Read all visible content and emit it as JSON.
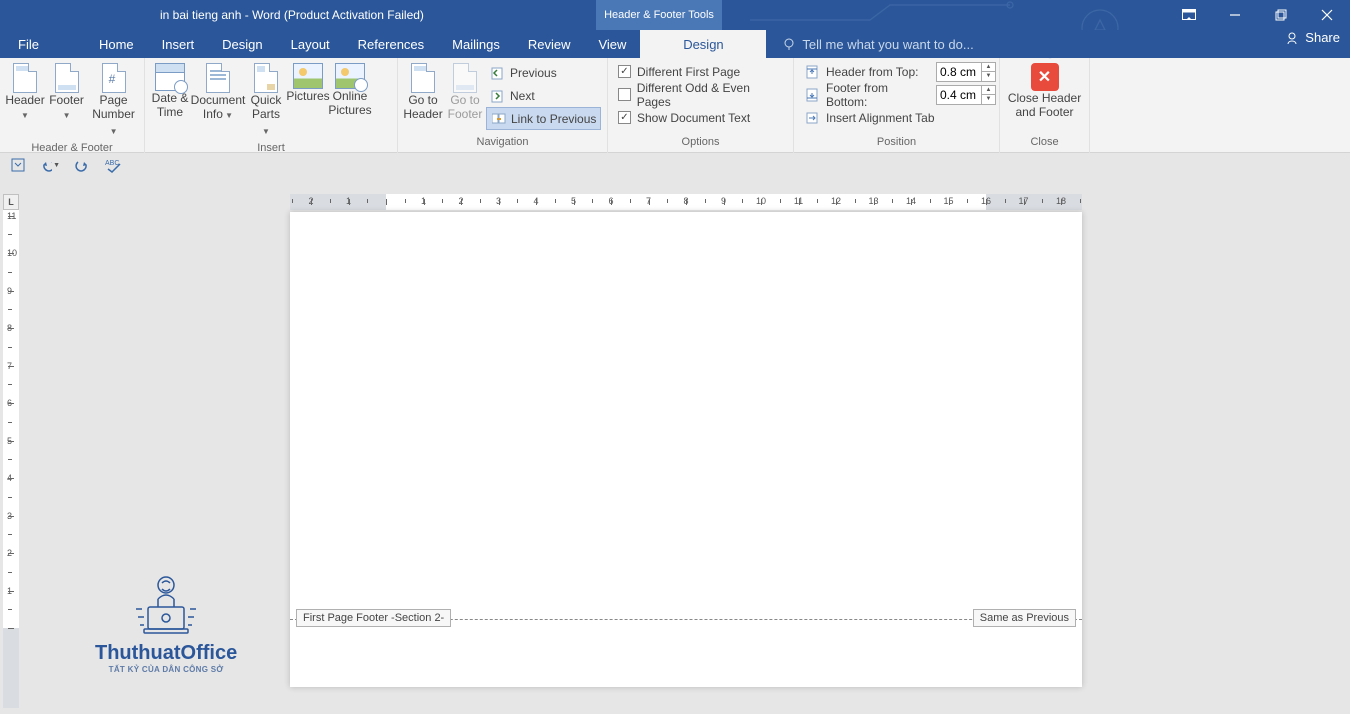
{
  "title": "in bai tieng anh - Word (Product Activation Failed)",
  "context_tab": "Header & Footer Tools",
  "tabs": [
    "File",
    "Home",
    "Insert",
    "Design",
    "Layout",
    "References",
    "Mailings",
    "Review",
    "View"
  ],
  "design_tab": "Design",
  "tellme": "Tell me what you want to do...",
  "share": "Share",
  "ribbon": {
    "groups": {
      "hf": {
        "title": "Header & Footer",
        "header": "Header",
        "footer": "Footer",
        "page_number": "Page\nNumber"
      },
      "insert": {
        "title": "Insert",
        "date_time": "Date &\nTime",
        "doc_info": "Document\nInfo",
        "quick_parts": "Quick\nParts",
        "pictures": "Pictures",
        "online_pictures": "Online\nPictures"
      },
      "navigation": {
        "title": "Navigation",
        "goto_header": "Go to\nHeader",
        "goto_footer": "Go to\nFooter",
        "previous": "Previous",
        "next": "Next",
        "link_previous": "Link to Previous"
      },
      "options": {
        "title": "Options",
        "diff_first": "Different First Page",
        "diff_odd_even": "Different Odd & Even Pages",
        "show_doc_text": "Show Document Text",
        "checked": {
          "diff_first": true,
          "diff_odd_even": false,
          "show_doc_text": true
        }
      },
      "position": {
        "title": "Position",
        "header_from_top": "Header from Top:",
        "footer_from_bottom": "Footer from Bottom:",
        "insert_align_tab": "Insert Alignment Tab",
        "header_val": "0.8 cm",
        "footer_val": "0.4 cm"
      },
      "close": {
        "title": "Close",
        "label": "Close Header\nand Footer"
      }
    }
  },
  "page": {
    "footer_left": "First Page Footer -Section 2-",
    "footer_right": "Same as Previous"
  },
  "logo": {
    "main": "ThuthuatOffice",
    "sub": "TẤT KỶ CỦA DÂN CÔNG SỞ"
  },
  "ruler_corner": "L"
}
